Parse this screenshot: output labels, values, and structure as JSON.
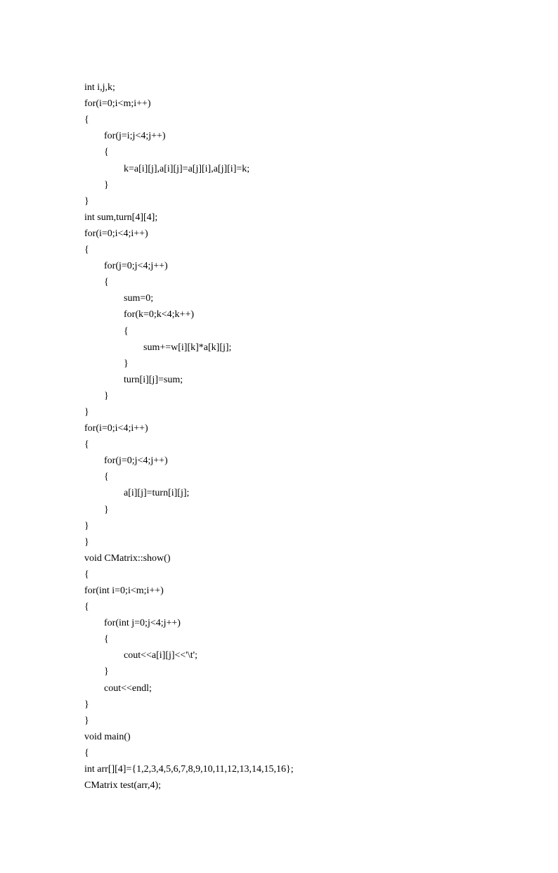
{
  "code": {
    "lines": [
      "int i,j,k;",
      "for(i=0;i<m;i++)",
      "{",
      "        for(j=i;j<4;j++)",
      "        {",
      "                k=a[i][j],a[i][j]=a[j][i],a[j][i]=k;",
      "        }",
      "}",
      "int sum,turn[4][4];",
      "for(i=0;i<4;i++)",
      "{",
      "        for(j=0;j<4;j++)",
      "        {",
      "                sum=0;",
      "                for(k=0;k<4;k++)",
      "                {",
      "                        sum+=w[i][k]*a[k][j];",
      "                }",
      "                turn[i][j]=sum;",
      "        }",
      "}",
      "for(i=0;i<4;i++)",
      "{",
      "        for(j=0;j<4;j++)",
      "        {",
      "                a[i][j]=turn[i][j];",
      "        }",
      "}",
      "}",
      "void CMatrix::show()",
      "{",
      "for(int i=0;i<m;i++)",
      "{",
      "        for(int j=0;j<4;j++)",
      "        {",
      "                cout<<a[i][j]<<'\\t';",
      "        }",
      "        cout<<endl;",
      "}",
      "}",
      "void main()",
      "{",
      "int arr[][4]={1,2,3,4,5,6,7,8,9,10,11,12,13,14,15,16};",
      "CMatrix test(arr,4);"
    ]
  }
}
